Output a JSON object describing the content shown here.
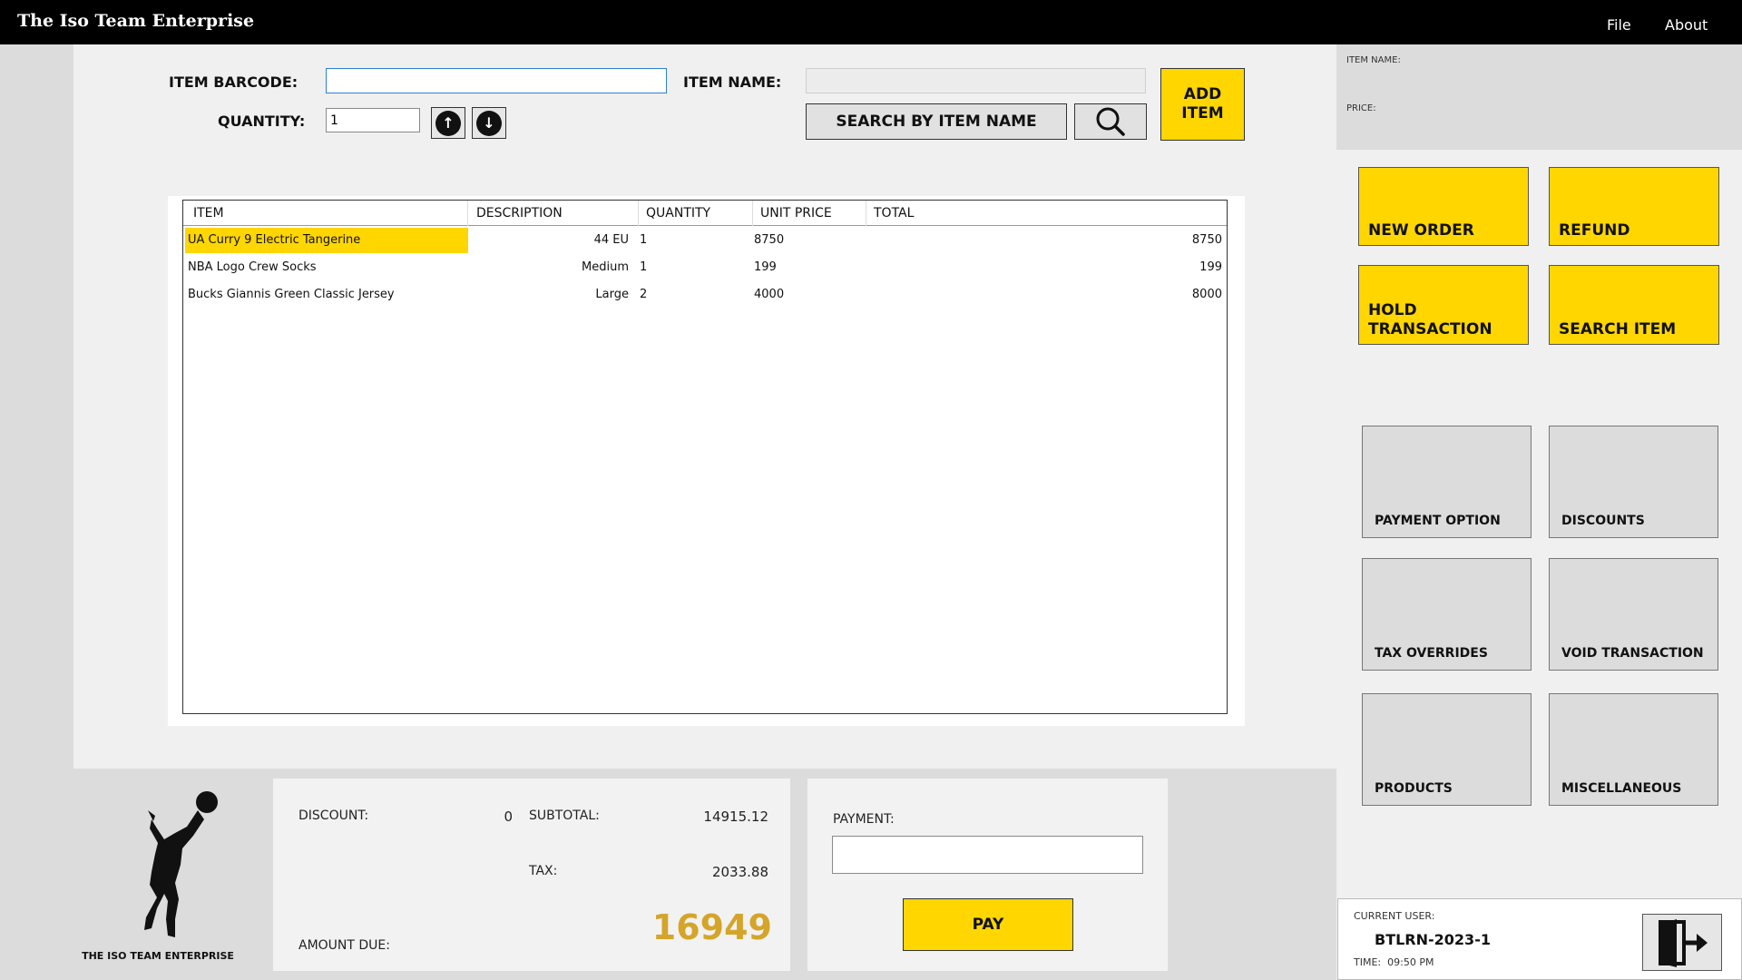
{
  "app": {
    "title": "The Iso Team Enterprise"
  },
  "menu": {
    "file": "File",
    "about": "About"
  },
  "entry": {
    "barcode_label": "ITEM BARCODE:",
    "barcode_value": "",
    "quantity_label": "QUANTITY:",
    "quantity_value": "1",
    "item_name_label": "ITEM NAME:",
    "item_name_value": "",
    "search_by_name": "SEARCH BY ITEM NAME",
    "add_item": "ADD ITEM"
  },
  "table": {
    "headers": [
      "ITEM",
      "DESCRIPTION",
      "QUANTITY",
      "UNIT PRICE",
      "TOTAL"
    ],
    "rows": [
      {
        "item": "UA Curry 9 Electric Tangerine",
        "description": "44 EU",
        "quantity": "1",
        "unit_price": "8750",
        "total": "8750",
        "selected": true
      },
      {
        "item": "NBA Logo Crew Socks",
        "description": "Medium",
        "quantity": "1",
        "unit_price": "199",
        "total": "199",
        "selected": false
      },
      {
        "item": "Bucks Giannis Green Classic Jersey",
        "description": "Large",
        "quantity": "2",
        "unit_price": "4000",
        "total": "8000",
        "selected": false
      }
    ]
  },
  "info": {
    "item_name_label": "ITEM NAME:",
    "price_label": "PRICE:"
  },
  "actions": {
    "new_order": "NEW ORDER",
    "refund": "REFUND",
    "hold_line1": "HOLD",
    "hold_line2": "TRANSACTION",
    "search_item": "SEARCH ITEM",
    "payment_option": "PAYMENT OPTION",
    "discounts": "DISCOUNTS",
    "tax_overrides": "TAX OVERRIDES",
    "void_transaction": "VOID TRANSACTION",
    "products": "PRODUCTS",
    "miscellaneous": "MISCELLANEOUS"
  },
  "summary": {
    "discount_label": "DISCOUNT:",
    "discount_value": "0",
    "subtotal_label": "SUBTOTAL:",
    "subtotal_value": "14915.12",
    "tax_label": "TAX:",
    "tax_value": "2033.88",
    "amount_due_label": "AMOUNT DUE:",
    "amount_due_value": "16949"
  },
  "payment": {
    "label": "PAYMENT:",
    "value": "",
    "pay_button": "PAY"
  },
  "logo": {
    "caption": "THE ISO TEAM ENTERPRISE"
  },
  "user": {
    "current_user_label": "CURRENT USER:",
    "current_user": "BTLRN-2023-1",
    "time_label": "TIME:",
    "time_value": "09:50 PM"
  },
  "colors": {
    "accent": "#ffd600",
    "amount_due": "#d4a52a",
    "titlebar": "#000000"
  },
  "icons": [
    "arrow-up-icon",
    "arrow-down-icon",
    "magnifier-icon",
    "logout-icon",
    "basketball-player-logo"
  ]
}
